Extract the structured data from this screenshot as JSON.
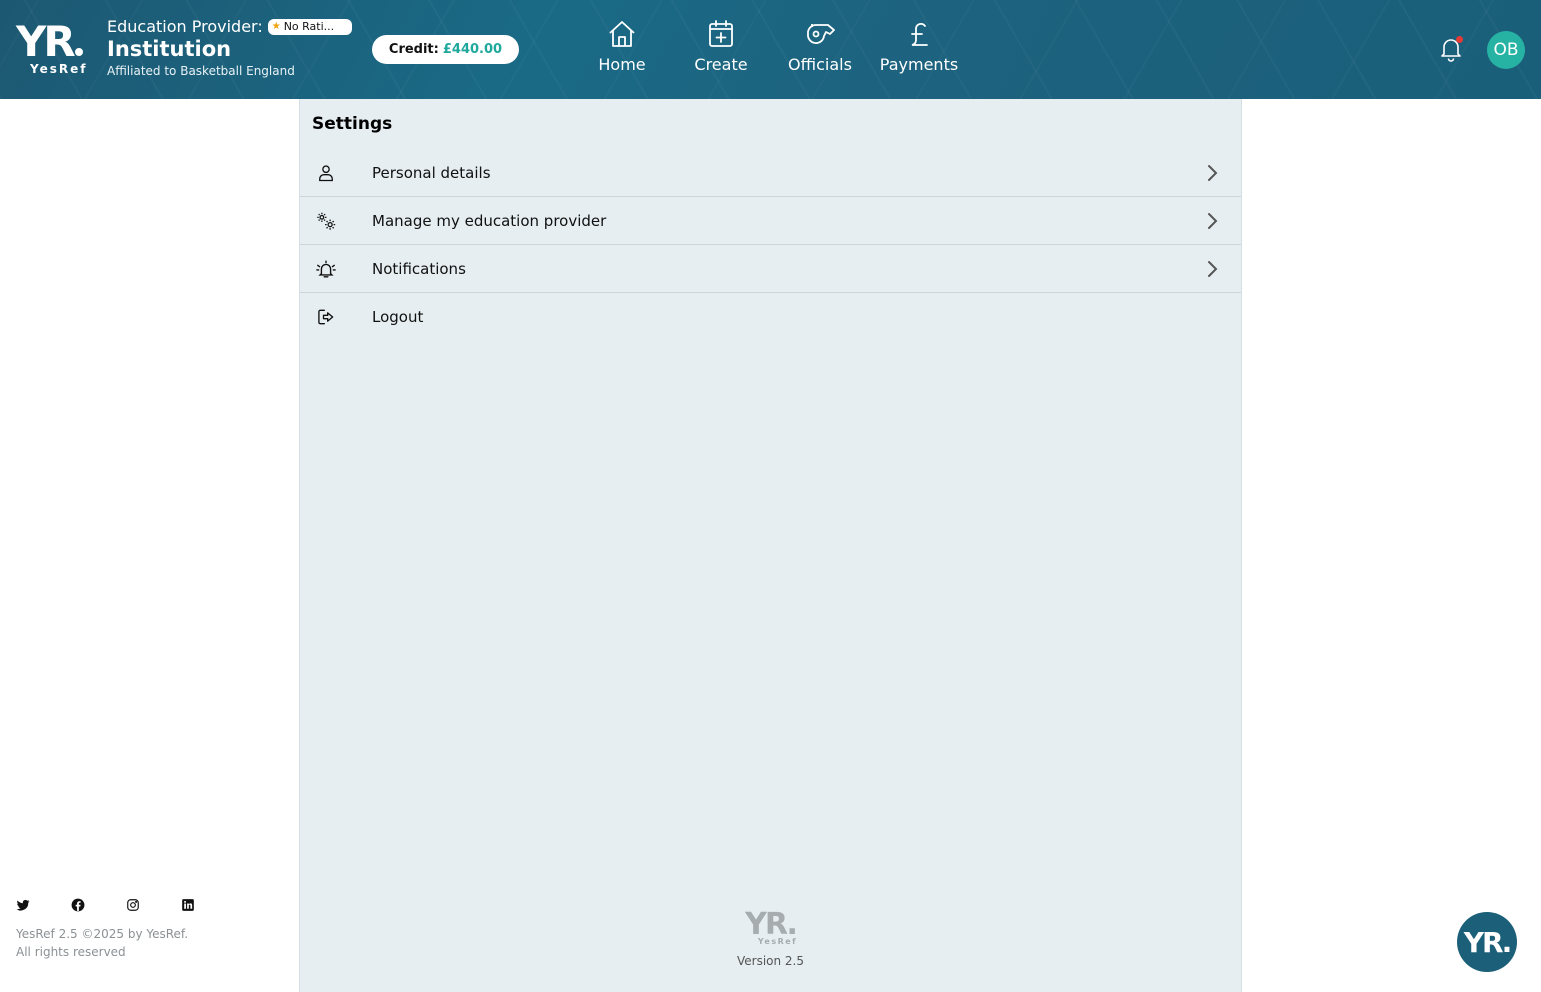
{
  "header": {
    "brand": {
      "logo": "YR",
      "name": "YesRef"
    },
    "provider_label": "Education Provider:",
    "rating": "No Rati...",
    "institution": "Institution",
    "affiliation": "Affiliated to Basketball England",
    "credit_label": "Credit:",
    "credit_amount": "£440.00",
    "nav": [
      {
        "label": "Home",
        "icon": "home-icon"
      },
      {
        "label": "Create",
        "icon": "calendar-plus-icon"
      },
      {
        "label": "Officials",
        "icon": "whistle-icon"
      },
      {
        "label": "Payments",
        "icon": "pound-icon"
      }
    ],
    "notification_dot": true,
    "avatar_initials": "OB"
  },
  "settings": {
    "title": "Settings",
    "items": [
      {
        "label": "Personal details",
        "icon": "person-icon",
        "has_chevron": true
      },
      {
        "label": "Manage my education provider",
        "icon": "gears-icon",
        "has_chevron": true
      },
      {
        "label": "Notifications",
        "icon": "bell-ring-icon",
        "has_chevron": true
      },
      {
        "label": "Logout",
        "icon": "logout-icon",
        "has_chevron": false
      }
    ],
    "footer_logo": {
      "logo": "YR",
      "name": "YesRef"
    },
    "version": "Version 2.5"
  },
  "footer": {
    "social": [
      "twitter-icon",
      "facebook-icon",
      "instagram-icon",
      "linkedin-icon"
    ],
    "copyright_line1": "YesRef 2.5 ©2025 by YesRef.",
    "copyright_line2": "All rights reserved"
  },
  "fab": {
    "logo": "YR"
  },
  "colors": {
    "header_bg": "#1a6a86",
    "accent": "#1fa89c",
    "avatar_bg": "#27b3a4",
    "panel_bg": "#e6eef1"
  }
}
